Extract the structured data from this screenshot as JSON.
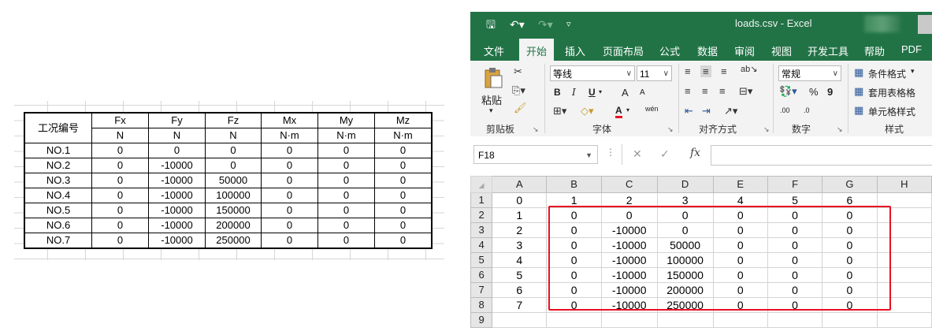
{
  "left_table": {
    "header_label": "工况编号",
    "columns": [
      {
        "name": "Fx",
        "unit": "N"
      },
      {
        "name": "Fy",
        "unit": "N"
      },
      {
        "name": "Fz",
        "unit": "N"
      },
      {
        "name": "Mx",
        "unit": "N·m"
      },
      {
        "name": "My",
        "unit": "N·m"
      },
      {
        "name": "Mz",
        "unit": "N·m"
      }
    ],
    "rows": [
      {
        "id": "NO.1",
        "values": [
          "0",
          "0",
          "0",
          "0",
          "0",
          "0"
        ]
      },
      {
        "id": "NO.2",
        "values": [
          "0",
          "-10000",
          "0",
          "0",
          "0",
          "0"
        ]
      },
      {
        "id": "NO.3",
        "values": [
          "0",
          "-10000",
          "50000",
          "0",
          "0",
          "0"
        ]
      },
      {
        "id": "NO.4",
        "values": [
          "0",
          "-10000",
          "100000",
          "0",
          "0",
          "0"
        ]
      },
      {
        "id": "NO.5",
        "values": [
          "0",
          "-10000",
          "150000",
          "0",
          "0",
          "0"
        ]
      },
      {
        "id": "NO.6",
        "values": [
          "0",
          "-10000",
          "200000",
          "0",
          "0",
          "0"
        ]
      },
      {
        "id": "NO.7",
        "values": [
          "0",
          "-10000",
          "250000",
          "0",
          "0",
          "0"
        ]
      }
    ]
  },
  "excel": {
    "title": "loads.csv  -  Excel",
    "tabs": [
      "文件",
      "开始",
      "插入",
      "页面布局",
      "公式",
      "数据",
      "审阅",
      "视图",
      "开发工具",
      "帮助",
      "PDF"
    ],
    "active_tab": "开始",
    "ribbon": {
      "clipboard_label": "剪贴板",
      "paste_label": "粘贴",
      "font_label": "字体",
      "font_name": "等线",
      "font_size": "11",
      "bold": "B",
      "italic": "I",
      "underline": "U",
      "grow_font": "A",
      "shrink_font": "A",
      "font_color": "A",
      "phonetic": "wén",
      "alignment_label": "对齐方式",
      "number_label": "数字",
      "number_format": "常规",
      "percent": "%",
      "comma": "9",
      "inc_decimal": ".00",
      "dec_decimal": ".0",
      "styles_label": "样式",
      "conditional_format": "条件格式",
      "table_format": "套用表格格",
      "cell_styles": "单元格样式"
    },
    "name_box": "F18",
    "formula_value": "",
    "column_headers": [
      "A",
      "B",
      "C",
      "D",
      "E",
      "F",
      "G",
      "H"
    ],
    "row_headers": [
      "1",
      "2",
      "3",
      "4",
      "5",
      "6",
      "7",
      "8",
      "9"
    ],
    "cells": [
      [
        "0",
        "1",
        "2",
        "3",
        "4",
        "5",
        "6",
        ""
      ],
      [
        "1",
        "0",
        "0",
        "0",
        "0",
        "0",
        "0",
        ""
      ],
      [
        "2",
        "0",
        "-10000",
        "0",
        "0",
        "0",
        "0",
        ""
      ],
      [
        "3",
        "0",
        "-10000",
        "50000",
        "0",
        "0",
        "0",
        ""
      ],
      [
        "4",
        "0",
        "-10000",
        "100000",
        "0",
        "0",
        "0",
        ""
      ],
      [
        "5",
        "0",
        "-10000",
        "150000",
        "0",
        "0",
        "0",
        ""
      ],
      [
        "6",
        "0",
        "-10000",
        "200000",
        "0",
        "0",
        "0",
        ""
      ],
      [
        "7",
        "0",
        "-10000",
        "250000",
        "0",
        "0",
        "0",
        ""
      ],
      [
        "",
        "",
        "",
        "",
        "",
        "",
        "",
        ""
      ]
    ],
    "highlight_color": "#e81123",
    "accent_color": "#217346"
  }
}
